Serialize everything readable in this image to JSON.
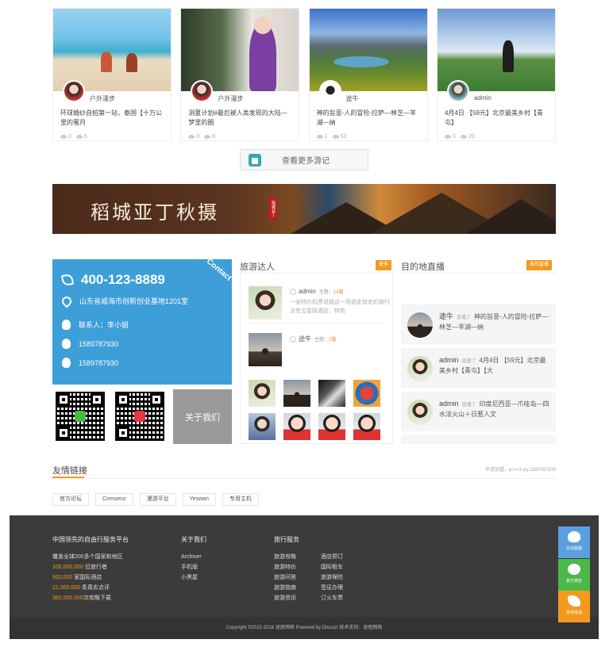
{
  "cards": [
    {
      "author": "户外漫步",
      "title": "环球婚纱自拍第一站，泰国【十万公里的蜜月",
      "likes": "0",
      "views": "5"
    },
    {
      "author": "户外漫步",
      "title": "洞夏计划#最后被人类发现的大陆—梦里的圈",
      "likes": "0",
      "views": "8"
    },
    {
      "author": "途牛",
      "title": "神的旨意-人的冒险-拉萨—林芝—羊湖—纳",
      "likes": "1",
      "views": "52"
    },
    {
      "author": "admin",
      "title": "4月4日 【59元】北京最美乡村【青屯】",
      "likes": "0",
      "views": "20"
    }
  ],
  "more_button": "查看更多游记",
  "banner": {
    "title": "稻城亚丁秋摄",
    "seal": "稻城亚丁"
  },
  "contact": {
    "corner": "Contact",
    "phone": "400-123-8889",
    "address": "山东省威海市创新创业基地1201室",
    "contact_person": "联系人：李小姐",
    "qq1": "1589787930",
    "qq2": "1589787930"
  },
  "about_button": "关于我们",
  "experts": {
    "title": "旅游达人",
    "more": "更多",
    "list": [
      {
        "name": "admin",
        "label": "主题：",
        "count": "14篇",
        "desc": "一张特价机票说就这一场说走就走的旅行 没有五星级酒店，特色"
      },
      {
        "name": "途牛",
        "label": "主题：",
        "count": "2篇",
        "desc": ""
      }
    ]
  },
  "feed": {
    "title": "目的地直播",
    "post": "发布直播",
    "items": [
      {
        "user": "途牛",
        "verb": "直播了",
        "text": "神的旨意-人的冒险-拉萨—林芝—羊湖—纳"
      },
      {
        "user": "admin",
        "verb": "直播了",
        "text": "4月4日 【59元】北京最美乡村【青屯】【大"
      },
      {
        "user": "admin",
        "verb": "直播了",
        "text": "印度尼西亚—爪哇岛—四水法火山＋日惹人文"
      }
    ]
  },
  "friend_links": {
    "title": "友情链接",
    "apply": "申请加盟，pr>=3,qq:1589787930",
    "items": [
      "官方论坛",
      "Comsenz",
      "漫游平台",
      "Yeswan",
      "专用主机"
    ]
  },
  "footer": {
    "col1_title": "中国领先的自由行服务平台",
    "col1_lines": [
      {
        "hl": "",
        "text": "覆盖全球200多个国家和地区"
      },
      {
        "hl": "100,000,000",
        "text": " 位旅行者"
      },
      {
        "hl": "920,000",
        "text": " 家国际酒店"
      },
      {
        "hl": "21,000,000",
        "text": " 条真实点评"
      },
      {
        "hl": "382,000,000",
        "text": "次攻略下载"
      }
    ],
    "col2_title": "关于我们",
    "col2_lines": [
      "Archiver",
      "手机版",
      "小黑屋"
    ],
    "col3_title": "旅行服务",
    "col3a_lines": [
      "旅游攻略",
      "旅游特价",
      "旅游问答",
      "旅游指南",
      "旅游资讯"
    ],
    "col3b_lines": [
      "酒店预订",
      "国际租车",
      "旅游保险",
      "签证办理",
      "订火车票"
    ],
    "copyright": "Copyright ©2015-2016 途居网络 Powered by Discuz! 技术支持：途居网络"
  },
  "side": {
    "online": "在线客服",
    "wechat": "官方微信",
    "hotline": "咨询电话"
  }
}
